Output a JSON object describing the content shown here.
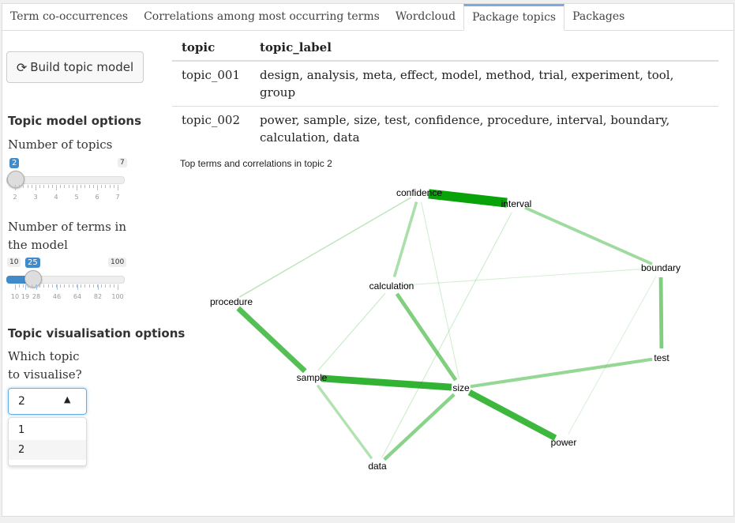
{
  "tabs": [
    "Term co-occurrences",
    "Correlations among most occurring terms",
    "Wordcloud",
    "Package topics",
    "Packages"
  ],
  "active_tab": "Package topics",
  "sidebar": {
    "build_button": "Build topic model",
    "build_icon": "refresh-icon",
    "options_heading": "Topic model options",
    "num_topics": {
      "label": "Number of topics",
      "min": "2",
      "max": "7",
      "value": "2",
      "ticks": [
        "2",
        "3",
        "4",
        "5",
        "6",
        "7"
      ]
    },
    "num_terms": {
      "label_line1": "Number of terms in",
      "label_line2": "the model",
      "min": "10",
      "max": "100",
      "value": "25",
      "ticks": [
        "10",
        "19",
        "28",
        "46",
        "64",
        "82",
        "100"
      ]
    },
    "vis_heading": "Topic visualisation options",
    "which_topic": {
      "label_line1": "Which topic",
      "label_line2": "to visualise?",
      "value": "2",
      "options": [
        "1",
        "2"
      ]
    }
  },
  "table": {
    "headers": [
      "topic",
      "topic_label"
    ],
    "rows": [
      [
        "topic_001",
        "design, analysis, meta, effect, model, method, trial, experiment, tool, group"
      ],
      [
        "topic_002",
        "power, sample, size, test, confidence, procedure, interval, boundary, calculation, data"
      ]
    ]
  },
  "chart_data": {
    "type": "network",
    "title": "Top terms and correlations in topic 2",
    "edge_color": "#00a000",
    "nodes": [
      "confidence",
      "interval",
      "boundary",
      "calculation",
      "procedure",
      "test",
      "sample",
      "size",
      "power",
      "data"
    ],
    "edges": [
      {
        "from": "confidence",
        "to": "interval",
        "strength": 1.0
      },
      {
        "from": "sample",
        "to": "size",
        "strength": 0.8
      },
      {
        "from": "size",
        "to": "power",
        "strength": 0.75
      },
      {
        "from": "procedure",
        "to": "sample",
        "strength": 0.65
      },
      {
        "from": "calculation",
        "to": "size",
        "strength": 0.45
      },
      {
        "from": "boundary",
        "to": "test",
        "strength": 0.45
      },
      {
        "from": "size",
        "to": "data",
        "strength": 0.4
      },
      {
        "from": "size",
        "to": "test",
        "strength": 0.35
      },
      {
        "from": "interval",
        "to": "boundary",
        "strength": 0.3
      },
      {
        "from": "confidence",
        "to": "calculation",
        "strength": 0.25
      },
      {
        "from": "sample",
        "to": "data",
        "strength": 0.22
      },
      {
        "from": "confidence",
        "to": "procedure",
        "strength": 0.2
      },
      {
        "from": "calculation",
        "to": "sample",
        "strength": 0.12
      },
      {
        "from": "interval",
        "to": "data",
        "strength": 0.1
      },
      {
        "from": "confidence",
        "to": "size",
        "strength": 0.08
      },
      {
        "from": "calculation",
        "to": "boundary",
        "strength": 0.06
      },
      {
        "from": "boundary",
        "to": "power",
        "strength": 0.05
      }
    ]
  }
}
